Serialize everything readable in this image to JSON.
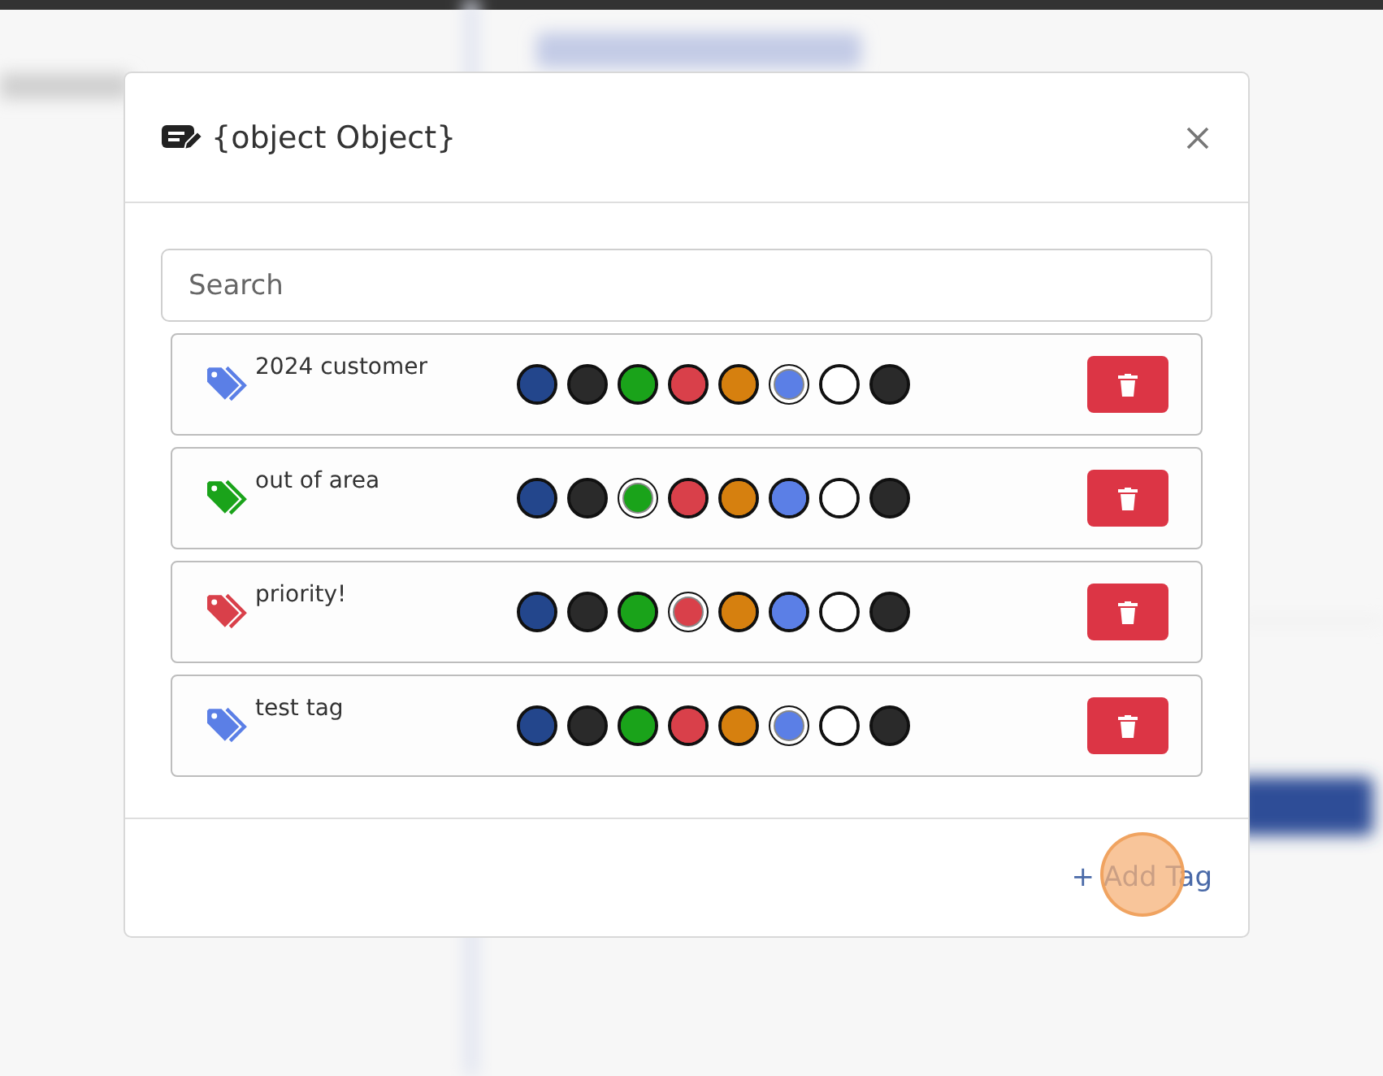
{
  "dialog": {
    "title": "{object Object}",
    "search": {
      "placeholder": "Search"
    },
    "tags": [
      {
        "name": "2024 customer",
        "color": "#5b7fe6",
        "swatches": [
          {
            "color": "#23468c",
            "selected": false
          },
          {
            "color": "#2a2a2a",
            "selected": false
          },
          {
            "color": "#1aa31a",
            "selected": false
          },
          {
            "color": "#d9404a",
            "selected": false
          },
          {
            "color": "#d6800f",
            "selected": false
          },
          {
            "color": "#5b7fe6",
            "selected": true
          },
          {
            "color": "#ffffff",
            "selected": false
          },
          {
            "color": "#2a2a2a",
            "selected": false
          }
        ]
      },
      {
        "name": "out of area",
        "color": "#1aa31a",
        "swatches": [
          {
            "color": "#23468c",
            "selected": false
          },
          {
            "color": "#2a2a2a",
            "selected": false
          },
          {
            "color": "#1aa31a",
            "selected": true
          },
          {
            "color": "#d9404a",
            "selected": false
          },
          {
            "color": "#d6800f",
            "selected": false
          },
          {
            "color": "#5b7fe6",
            "selected": false
          },
          {
            "color": "#ffffff",
            "selected": false
          },
          {
            "color": "#2a2a2a",
            "selected": false
          }
        ]
      },
      {
        "name": "priority!",
        "color": "#d9404a",
        "swatches": [
          {
            "color": "#23468c",
            "selected": false
          },
          {
            "color": "#2a2a2a",
            "selected": false
          },
          {
            "color": "#1aa31a",
            "selected": false
          },
          {
            "color": "#d9404a",
            "selected": true
          },
          {
            "color": "#d6800f",
            "selected": false
          },
          {
            "color": "#5b7fe6",
            "selected": false
          },
          {
            "color": "#ffffff",
            "selected": false
          },
          {
            "color": "#2a2a2a",
            "selected": false
          }
        ]
      },
      {
        "name": "test tag",
        "color": "#5b7fe6",
        "swatches": [
          {
            "color": "#23468c",
            "selected": false
          },
          {
            "color": "#2a2a2a",
            "selected": false
          },
          {
            "color": "#1aa31a",
            "selected": false
          },
          {
            "color": "#d9404a",
            "selected": false
          },
          {
            "color": "#d6800f",
            "selected": false
          },
          {
            "color": "#5b7fe6",
            "selected": true
          },
          {
            "color": "#ffffff",
            "selected": false
          },
          {
            "color": "#2a2a2a",
            "selected": false
          }
        ]
      }
    ],
    "add_button": {
      "label": "+ Add Tag"
    }
  }
}
